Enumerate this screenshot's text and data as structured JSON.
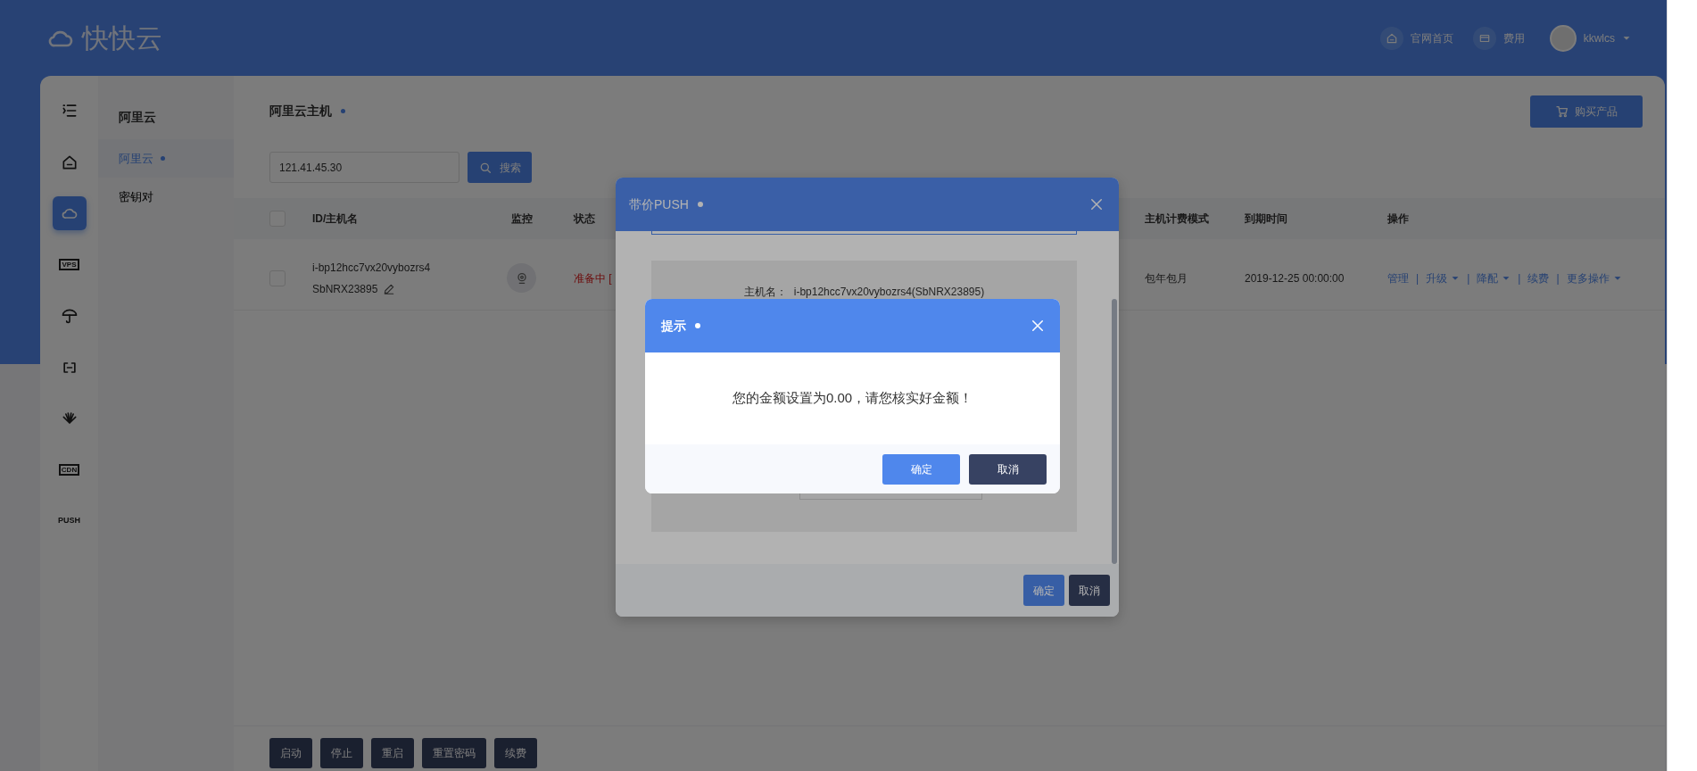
{
  "header": {
    "logo": "快快云",
    "links": [
      {
        "kind": "home",
        "label": "官网首页"
      },
      {
        "kind": "wallet",
        "label": "费用"
      }
    ],
    "user": "kkwlcs"
  },
  "rail": [
    {
      "kind": "menu",
      "selected": false
    },
    {
      "kind": "home",
      "selected": false
    },
    {
      "kind": "cloud",
      "selected": true
    },
    {
      "kind": "tag",
      "label": "VPS",
      "selected": false
    },
    {
      "kind": "umbrella",
      "selected": false
    },
    {
      "kind": "bracket",
      "selected": false
    },
    {
      "kind": "flower",
      "selected": false
    },
    {
      "kind": "tag",
      "label": "CDN",
      "selected": false
    },
    {
      "kind": "text",
      "label": "PUSH",
      "selected": false
    }
  ],
  "submenu": {
    "title": "阿里云",
    "items": [
      {
        "label": "阿里云",
        "selected": true
      },
      {
        "label": "密钥对",
        "selected": false
      }
    ]
  },
  "page_title": "阿里云主机",
  "buy_button": "购买产品",
  "search": {
    "value": "121.41.45.30",
    "button": "搜索"
  },
  "table": {
    "columns": [
      "ID/主机名",
      "监控",
      "状态",
      "主机计费模式",
      "到期时间",
      "操作"
    ],
    "select_all_checked": false,
    "rows": [
      {
        "checked": false,
        "id": "i-bp12hcc7vx20vybozrs4",
        "hostname": "SbNRX23895",
        "status": "准备中 [",
        "billing": "包年包月",
        "expiry": "2019-12-25 00:00:00",
        "actions": [
          {
            "label": "管理",
            "dropdown": false
          },
          {
            "separator": "|",
            "label": "升级",
            "dropdown": true
          },
          {
            "separator": "|",
            "label": "降配",
            "dropdown": true
          },
          {
            "separator": "|",
            "label": "续费",
            "dropdown": false
          },
          {
            "separator": "|",
            "label": "更多操作",
            "dropdown": true
          }
        ]
      }
    ]
  },
  "bulk_buttons": [
    "启动",
    "停止",
    "重启",
    "重置密码",
    "续费"
  ],
  "push_dialog": {
    "title": "带价PUSH",
    "host_label": "主机名：",
    "host_value": "i-bp12hcc7vx20vybozrs4(SbNRX23895)",
    "buttons": [
      {
        "kind": "primary",
        "label": "确定"
      },
      {
        "kind": "secondary",
        "label": "取消"
      }
    ]
  },
  "alert_dialog": {
    "title": "提示",
    "message": "您的金额设置为0.00，请您核实好金额！",
    "buttons": [
      {
        "kind": "primary",
        "label": "确定"
      },
      {
        "kind": "secondary",
        "label": "取消"
      }
    ]
  }
}
